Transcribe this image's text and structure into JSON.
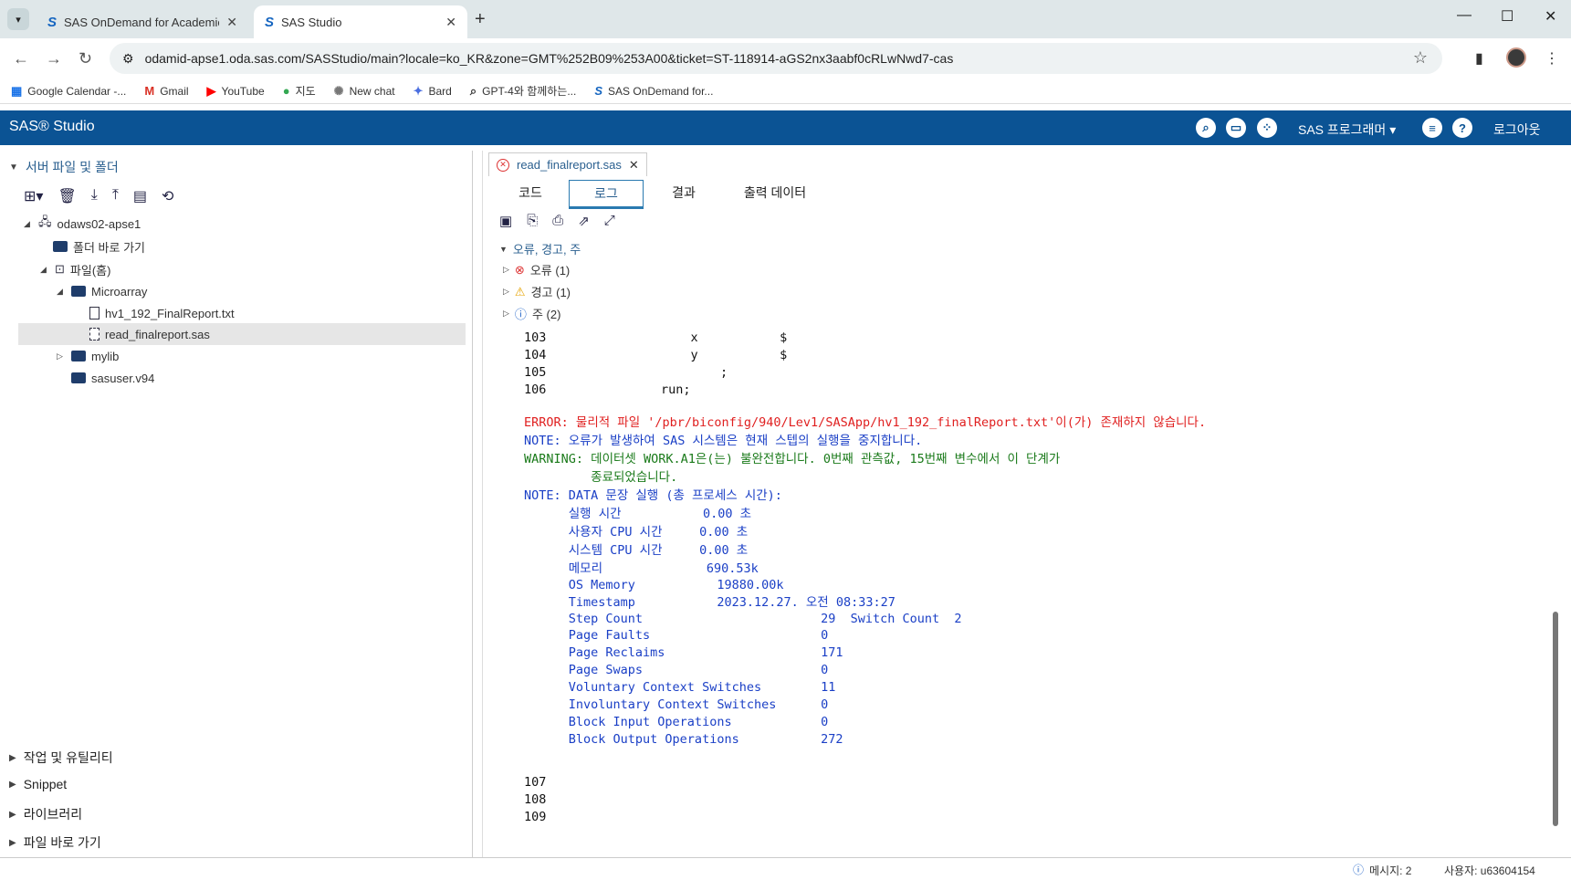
{
  "browser": {
    "tabs": [
      {
        "title": "SAS OnDemand for Academic",
        "icon": "sas-favicon"
      },
      {
        "title": "SAS Studio",
        "icon": "sas-favicon"
      }
    ],
    "url": "odamid-apse1.oda.sas.com/SASStudio/main?locale=ko_KR&zone=GMT%252B09%253A00&ticket=ST-118914-aGS2nx3aabf0cRLwNwd7-cas",
    "bookmarks": [
      {
        "label": "Google Calendar -...",
        "icon": "calendar-icon"
      },
      {
        "label": "Gmail",
        "icon": "gmail-icon"
      },
      {
        "label": "YouTube",
        "icon": "youtube-icon"
      },
      {
        "label": "지도",
        "icon": "maps-icon"
      },
      {
        "label": "New chat",
        "icon": "chatgpt-icon"
      },
      {
        "label": "Bard",
        "icon": "bard-icon"
      },
      {
        "label": "GPT-4와 함께하는...",
        "icon": "search-icon"
      },
      {
        "label": "SAS OnDemand for...",
        "icon": "sas-favicon"
      }
    ]
  },
  "sas": {
    "logo": "SAS® Studio",
    "program_menu": "SAS 프로그래머",
    "logout": "로그아웃"
  },
  "left": {
    "section_title": "서버 파일 및 폴더",
    "tree": [
      {
        "label": "odaws02-apse1"
      },
      {
        "label": "폴더 바로 가기"
      },
      {
        "label": "파일(홈)"
      },
      {
        "label": "Microarray"
      },
      {
        "label": "hv1_192_FinalReport.txt"
      },
      {
        "label": "read_finalreport.sas"
      },
      {
        "label": "mylib"
      },
      {
        "label": "sasuser.v94"
      }
    ],
    "bottom_sections": [
      "작업 및 유틸리티",
      "Snippet",
      "라이브러리",
      "파일 바로 가기"
    ]
  },
  "editor": {
    "file_tab": "read_finalreport.sas",
    "subtabs": [
      "코드",
      "로그",
      "결과",
      "출력 데이터"
    ],
    "active_subtab": "로그",
    "summary_title": "오류, 경고, 주",
    "summary": [
      {
        "label": "오류 (1)",
        "icon": "error-icon"
      },
      {
        "label": "경고 (1)",
        "icon": "warning-icon"
      },
      {
        "label": "주 (2)",
        "icon": "info-icon"
      }
    ],
    "code_lines": [
      {
        "num": "103",
        "text": "            x           $"
      },
      {
        "num": "104",
        "text": "            y           $"
      },
      {
        "num": "105",
        "text": "                ;"
      },
      {
        "num": "106",
        "text": "        run;"
      }
    ],
    "messages": {
      "error": "ERROR: 물리적 파일 '/pbr/biconfig/940/Lev1/SASApp/hv1_192_finalReport.txt'이(가) 존재하지 않습니다.",
      "note1": "NOTE: 오류가 발생하여 SAS 시스템은 현재 스텝의 실행을 중지합니다.",
      "warning1": "WARNING: 데이터셋 WORK.A1은(는) 불완전합니다. 0번째 관측값, 15번째 변수에서 이 단계가",
      "warning2": "         종료되었습니다.",
      "note2": "NOTE: DATA 문장 실행 (총 프로세스 시간):"
    },
    "stats": [
      "      실행 시간           0.00 초",
      "      사용자 CPU 시간     0.00 초",
      "      시스템 CPU 시간     0.00 초",
      "      메모리              690.53k",
      "      OS Memory           19880.00k",
      "      Timestamp           2023.12.27. 오전 08:33:27",
      "      Step Count                        29  Switch Count  2",
      "      Page Faults                       0",
      "      Page Reclaims                     171",
      "      Page Swaps                        0",
      "      Voluntary Context Switches        11",
      "      Involuntary Context Switches      0",
      "      Block Input Operations            0",
      "      Block Output Operations           272"
    ],
    "trailing_lines": [
      "107",
      "108",
      "109"
    ]
  },
  "status": {
    "messages": "메시지: 2",
    "user": "사용자: u63604154"
  }
}
